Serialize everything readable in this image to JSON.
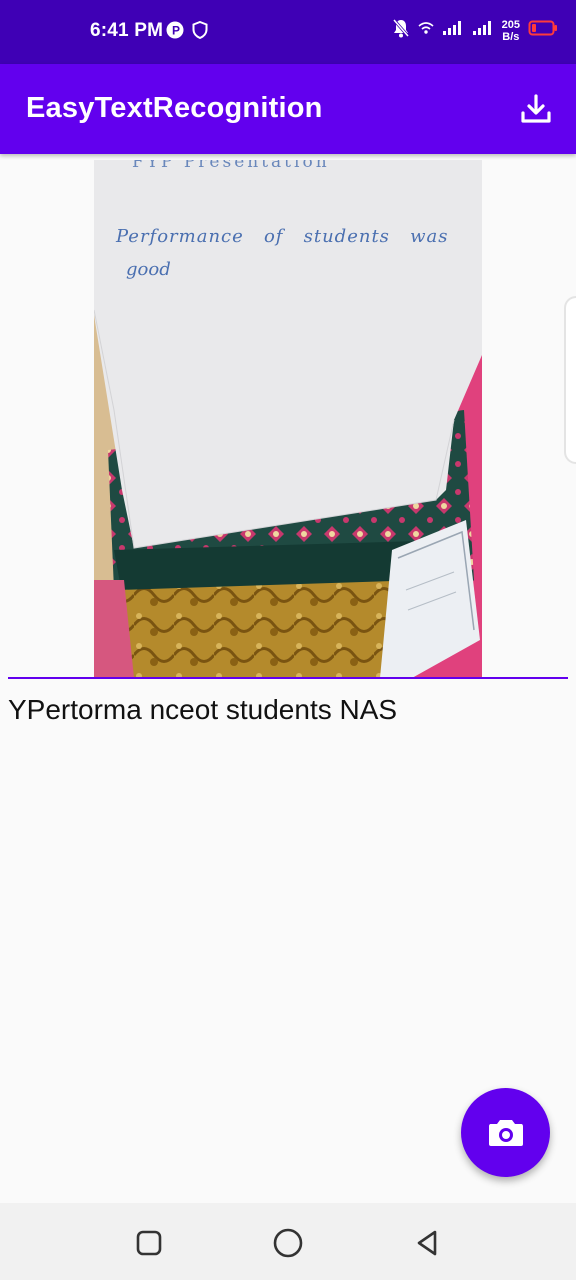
{
  "status_bar": {
    "time": "6:41 PM",
    "net_speed_value": "205",
    "net_speed_unit": "B/s",
    "icons": [
      "p-app-icon",
      "shield-icon",
      "bell-off-icon",
      "wifi-icon",
      "signal-icon",
      "signal-icon-2",
      "battery-low-icon"
    ]
  },
  "app_bar": {
    "title": "EasyTextRecognition",
    "download_icon": "download-icon"
  },
  "photo": {
    "handwriting_header": "FYP Presentation",
    "handwriting_line1": "Performance   of   students   was",
    "handwriting_line2": "good"
  },
  "result": {
    "text": "YPertorma nceot students NAS"
  },
  "fab": {
    "icon": "camera-icon"
  },
  "nav": {
    "icons": [
      "recents-square-icon",
      "home-circle-icon",
      "back-triangle-icon"
    ]
  },
  "colors": {
    "status_bar": "#3f00b5",
    "primary": "#6200ee",
    "background": "#fafafa"
  }
}
